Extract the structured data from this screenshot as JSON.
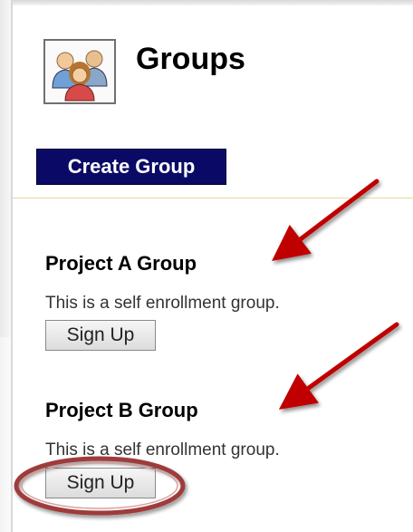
{
  "page": {
    "title": "Groups"
  },
  "toolbar": {
    "create_label": "Create Group"
  },
  "groups": [
    {
      "name": "Project A Group",
      "description": "This is a self enrollment group.",
      "signup_label": "Sign Up"
    },
    {
      "name": "Project B Group",
      "description": "This is a self enrollment group.",
      "signup_label": "Sign Up"
    }
  ],
  "icons": {
    "header": "group-people-icon"
  },
  "colors": {
    "create_button_bg": "#0a0a66",
    "annotation_arrow": "#c00000",
    "annotation_ellipse": "#a03a3a"
  }
}
